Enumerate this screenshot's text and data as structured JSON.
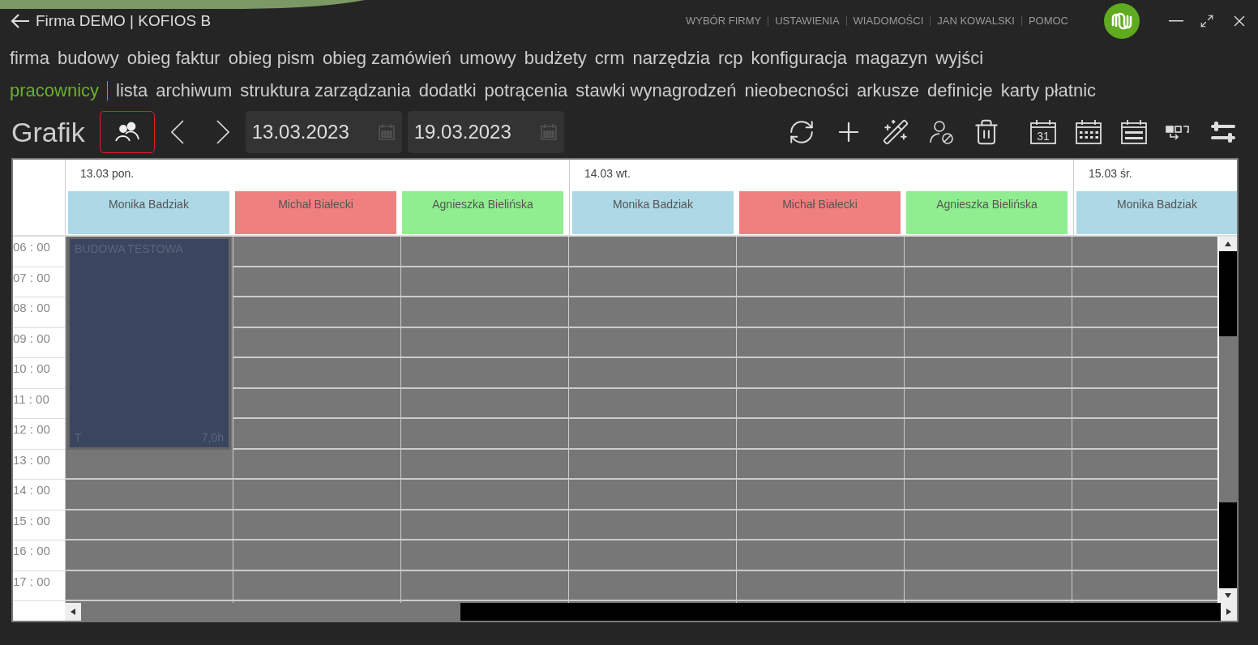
{
  "window": {
    "title": "Firma DEMO | KOFIOS B"
  },
  "top_links": [
    "WYBÓR FIRMY",
    "USTAWIENIA",
    "WIADOMOŚCI",
    "JAN KOWALSKI",
    "POMOC"
  ],
  "menu_primary": [
    "firma",
    "budowy",
    "obieg faktur",
    "obieg pism",
    "obieg zamówień",
    "umowy",
    "budżety",
    "crm",
    "narzędzia",
    "rcp",
    "konfiguracja",
    "magazyn",
    "wyjści"
  ],
  "menu_secondary": {
    "section": "pracownicy",
    "items": [
      "lista",
      "archiwum",
      "struktura zarządzania",
      "dodatki",
      "potrącenia",
      "stawki wynagrodzeń",
      "nieobecności",
      "arkusze",
      "definicje",
      "karty płatnic"
    ]
  },
  "toolbar": {
    "title": "Grafik",
    "employees_toggle": {
      "selected": true
    },
    "date_from": "13.03.2023",
    "date_to": "19.03.2023",
    "calendar_day": "31"
  },
  "schedule": {
    "days": [
      {
        "label": "13.03 pon.",
        "employees": [
          {
            "name": "Monika Badziak",
            "color": "#add8e6",
            "events": [
              {
                "title": "BUDOWA TESTOWA",
                "code": "T",
                "hours": "7,0h"
              }
            ]
          },
          {
            "name": "Michał Białecki",
            "color": "#f08080"
          },
          {
            "name": "Agnieszka Bielińska",
            "color": "#90ee90"
          }
        ]
      },
      {
        "label": "14.03 wt.",
        "employees": [
          {
            "name": "Monika Badziak",
            "color": "#add8e6"
          },
          {
            "name": "Michał Białecki",
            "color": "#f08080"
          },
          {
            "name": "Agnieszka Bielińska",
            "color": "#90ee90"
          }
        ]
      },
      {
        "label": "15.03 śr.",
        "employees": [
          {
            "name": "Monika Badziak",
            "color": "#add8e6"
          }
        ]
      }
    ],
    "times": [
      "06 : 00",
      "07 : 00",
      "08 : 00",
      "09 : 00",
      "10 : 00",
      "11 : 00",
      "12 : 00",
      "13 : 00",
      "14 : 00",
      "15 : 00",
      "16 : 00",
      "17 : 00"
    ]
  }
}
